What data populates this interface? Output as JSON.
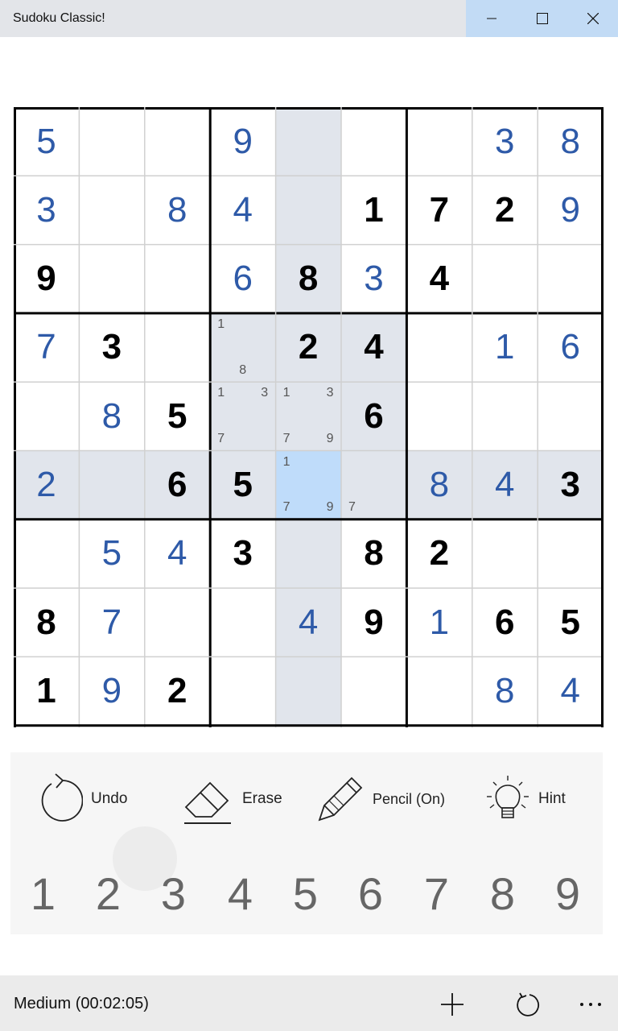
{
  "window": {
    "title": "Sudoku Classic!"
  },
  "board": {
    "selected": [
      5,
      4
    ],
    "highlight_color": "#e1e5ec",
    "selected_color": "#bfdcfa",
    "user_color": "#2e5aa8",
    "cells": [
      [
        {
          "v": "5",
          "t": "user"
        },
        {},
        {},
        {
          "v": "9",
          "t": "user"
        },
        {},
        {},
        {},
        {
          "v": "3",
          "t": "user"
        },
        {
          "v": "8",
          "t": "user"
        }
      ],
      [
        {
          "v": "3",
          "t": "user"
        },
        {},
        {
          "v": "8",
          "t": "user"
        },
        {
          "v": "4",
          "t": "user"
        },
        {},
        {
          "v": "1",
          "t": "given"
        },
        {
          "v": "7",
          "t": "given"
        },
        {
          "v": "2",
          "t": "given"
        },
        {
          "v": "9",
          "t": "user"
        }
      ],
      [
        {
          "v": "9",
          "t": "given"
        },
        {},
        {},
        {
          "v": "6",
          "t": "user"
        },
        {
          "v": "8",
          "t": "given"
        },
        {
          "v": "3",
          "t": "user"
        },
        {
          "v": "4",
          "t": "given"
        },
        {},
        {}
      ],
      [
        {
          "v": "7",
          "t": "user"
        },
        {
          "v": "3",
          "t": "given"
        },
        {},
        {
          "notes": [
            "1",
            "8"
          ]
        },
        {
          "v": "2",
          "t": "given"
        },
        {
          "v": "4",
          "t": "given"
        },
        {},
        {
          "v": "1",
          "t": "user"
        },
        {
          "v": "6",
          "t": "user"
        }
      ],
      [
        {},
        {
          "v": "8",
          "t": "user"
        },
        {
          "v": "5",
          "t": "given"
        },
        {
          "notes": [
            "1",
            "3",
            "7"
          ]
        },
        {
          "notes": [
            "1",
            "3",
            "7",
            "9"
          ]
        },
        {
          "v": "6",
          "t": "given"
        },
        {},
        {},
        {}
      ],
      [
        {
          "v": "2",
          "t": "user"
        },
        {},
        {
          "v": "6",
          "t": "given"
        },
        {
          "v": "5",
          "t": "given"
        },
        {
          "notes": [
            "1",
            "7",
            "9"
          ]
        },
        {
          "notes": [
            "7"
          ]
        },
        {
          "v": "8",
          "t": "user"
        },
        {
          "v": "4",
          "t": "user"
        },
        {
          "v": "3",
          "t": "given"
        }
      ],
      [
        {},
        {
          "v": "5",
          "t": "user"
        },
        {
          "v": "4",
          "t": "user"
        },
        {
          "v": "3",
          "t": "given"
        },
        {},
        {
          "v": "8",
          "t": "given"
        },
        {
          "v": "2",
          "t": "given"
        },
        {},
        {}
      ],
      [
        {
          "v": "8",
          "t": "given"
        },
        {
          "v": "7",
          "t": "user"
        },
        {},
        {},
        {
          "v": "4",
          "t": "user"
        },
        {
          "v": "9",
          "t": "given"
        },
        {
          "v": "1",
          "t": "user"
        },
        {
          "v": "6",
          "t": "given"
        },
        {
          "v": "5",
          "t": "given"
        }
      ],
      [
        {
          "v": "1",
          "t": "given"
        },
        {
          "v": "9",
          "t": "user"
        },
        {
          "v": "2",
          "t": "given"
        },
        {},
        {},
        {},
        {},
        {
          "v": "8",
          "t": "user"
        },
        {
          "v": "4",
          "t": "user"
        }
      ]
    ]
  },
  "tools": {
    "undo": {
      "label": "Undo",
      "icon": "undo-icon"
    },
    "erase": {
      "label": "Erase",
      "icon": "eraser-icon"
    },
    "pencil": {
      "label": "Pencil (On)",
      "icon": "pencil-icon"
    },
    "hint": {
      "label": "Hint",
      "icon": "lightbulb-icon"
    }
  },
  "numpad": [
    "1",
    "2",
    "3",
    "4",
    "5",
    "6",
    "7",
    "8",
    "9"
  ],
  "status": {
    "text": "Medium (00:02:05)"
  },
  "appbar": {
    "icons": [
      "add-icon",
      "refresh-icon",
      "more-icon"
    ]
  }
}
